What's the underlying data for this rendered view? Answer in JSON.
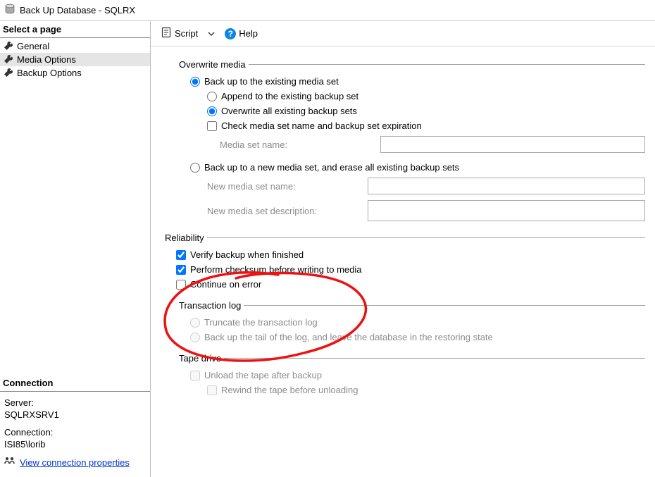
{
  "window": {
    "title": "Back Up Database - SQLRX"
  },
  "sidebar": {
    "select_page_heading": "Select a page",
    "items": [
      {
        "label": "General"
      },
      {
        "label": "Media Options"
      },
      {
        "label": "Backup Options"
      }
    ],
    "connection_heading": "Connection",
    "server_label": "Server:",
    "server_value": "SQLRXSRV1",
    "connection_label": "Connection:",
    "connection_value": "ISI85\\lorib",
    "view_conn_props": "View connection properties"
  },
  "toolbar": {
    "script_label": "Script",
    "help_label": "Help"
  },
  "panel": {
    "overwrite_legend": "Overwrite media",
    "opt_existing": "Back up to the existing media set",
    "opt_append": "Append to the existing backup set",
    "opt_overwrite_all": "Overwrite all existing backup sets",
    "chk_check_media": "Check media set name and backup set expiration",
    "lbl_media_set_name": "Media set name:",
    "opt_new_media": "Back up to a new media set, and erase all existing backup sets",
    "lbl_new_media_name": "New media set name:",
    "lbl_new_media_desc": "New media set description:",
    "reliability_legend": "Reliability",
    "chk_verify": "Verify backup when finished",
    "chk_checksum": "Perform checksum before writing to media",
    "chk_continue": "Continue on error",
    "txlog_legend": "Transaction log",
    "opt_truncate": "Truncate the transaction log",
    "opt_backup_tail": "Back up the tail of the log, and leave the database in the restoring state",
    "tape_legend": "Tape drive",
    "chk_unload": "Unload the tape after backup",
    "chk_rewind": "Rewind the tape before unloading"
  }
}
